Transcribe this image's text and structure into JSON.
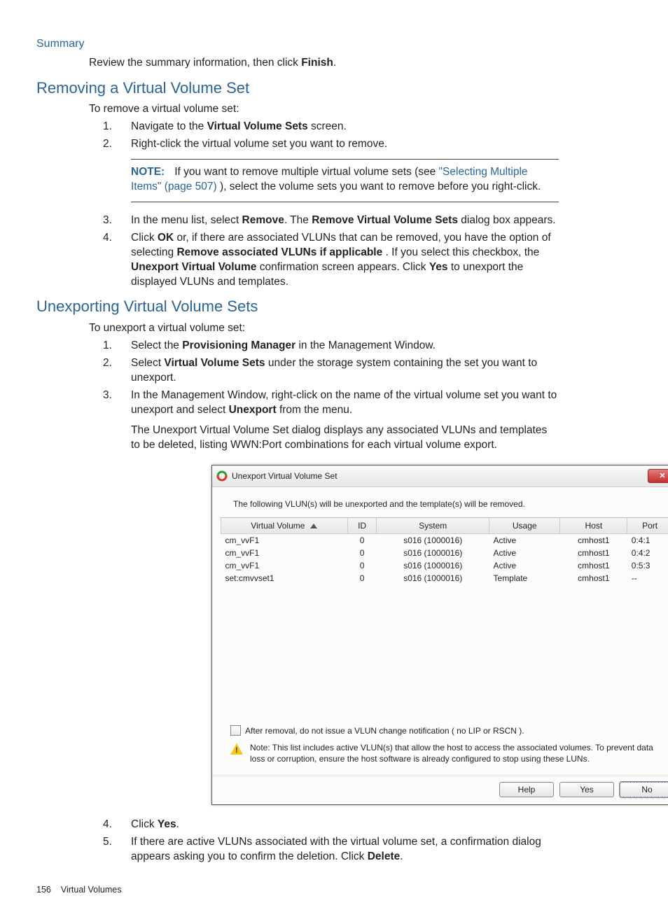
{
  "summary": {
    "title": "Summary",
    "text_a": "Review the summary information, then click ",
    "text_b": "Finish",
    "text_c": "."
  },
  "removing": {
    "title": "Removing a Virtual Volume Set",
    "intro": "To remove a virtual volume set:",
    "steps": {
      "s1n": "1.",
      "s1a": "Navigate to the ",
      "s1b": "Virtual Volume Sets",
      "s1c": " screen.",
      "s2n": "2.",
      "s2": "Right-click the virtual volume set you want to remove.",
      "note_label": "NOTE:",
      "note_a": "If you want to remove multiple virtual volume sets (see ",
      "note_link": "\"Selecting Multiple Items\" (page 507)",
      "note_b": " ), select the volume sets you want to remove before you right-click.",
      "s3n": "3.",
      "s3a": "In the menu list, select ",
      "s3b": "Remove",
      "s3c": ". The ",
      "s3d": "Remove Virtual Volume Sets",
      "s3e": " dialog box appears.",
      "s4n": "4.",
      "s4a": "Click ",
      "s4b": "OK",
      "s4c": " or, if there are associated VLUNs that can be removed, you have the option of selecting ",
      "s4d": "Remove associated VLUNs if applicable",
      "s4e": " . If you select this checkbox, the ",
      "s4f": "Unexport Virtual Volume",
      "s4g": " confirmation screen appears. Click ",
      "s4h": "Yes",
      "s4i": " to unexport the displayed VLUNs and templates."
    }
  },
  "unexporting": {
    "title": "Unexporting Virtual Volume Sets",
    "intro": "To unexport a virtual volume set:",
    "steps": {
      "s1n": "1.",
      "s1a": "Select the ",
      "s1b": "Provisioning Manager",
      "s1c": " in the Management Window.",
      "s2n": "2.",
      "s2a": "Select ",
      "s2b": "Virtual Volume Sets",
      "s2c": " under the storage system containing the set you want to unexport.",
      "s3n": "3.",
      "s3a": "In the Management Window, right-click on the name of the virtual volume set you want to unexport and select ",
      "s3b": "Unexport",
      "s3c": " from the menu.",
      "s3_para": "The Unexport Virtual Volume Set dialog displays any associated VLUNs and templates to be deleted, listing WWN:Port combinations for each virtual volume export.",
      "s4n": "4.",
      "s4a": "Click ",
      "s4b": "Yes",
      "s4c": ".",
      "s5n": "5.",
      "s5a": "If there are active VLUNs associated with the virtual volume set, a confirmation dialog appears asking you to confirm the deletion. Click ",
      "s5b": "Delete",
      "s5c": "."
    }
  },
  "dialog": {
    "title": "Unexport Virtual Volume Set",
    "desc": "The following VLUN(s) will be unexported and the template(s) will be removed.",
    "cols": {
      "virtual_volume": "Virtual Volume",
      "id": "ID",
      "system": "System",
      "usage": "Usage",
      "host": "Host",
      "port": "Port"
    },
    "rows": [
      {
        "vv": "cm_vvF1",
        "id": "0",
        "system": "s016 (1000016)",
        "usage": "Active",
        "host": "cmhost1",
        "port": "0:4:1"
      },
      {
        "vv": "cm_vvF1",
        "id": "0",
        "system": "s016 (1000016)",
        "usage": "Active",
        "host": "cmhost1",
        "port": "0:4:2"
      },
      {
        "vv": "cm_vvF1",
        "id": "0",
        "system": "s016 (1000016)",
        "usage": "Active",
        "host": "cmhost1",
        "port": "0:5:3"
      },
      {
        "vv": "set:cmvvset1",
        "id": "0",
        "system": "s016 (1000016)",
        "usage": "Template",
        "host": "cmhost1",
        "port": "--"
      }
    ],
    "checkbox": "After removal, do not issue a VLUN change notification ( no LIP or RSCN ).",
    "warn": "Note: This list includes active VLUN(s) that allow the host to access the associated volumes. To prevent data loss or corruption, ensure the host software is already configured to stop using these LUNs.",
    "help": "Help",
    "yes": "Yes",
    "no": "No"
  },
  "footer": {
    "page": "156",
    "section": "Virtual Volumes"
  }
}
